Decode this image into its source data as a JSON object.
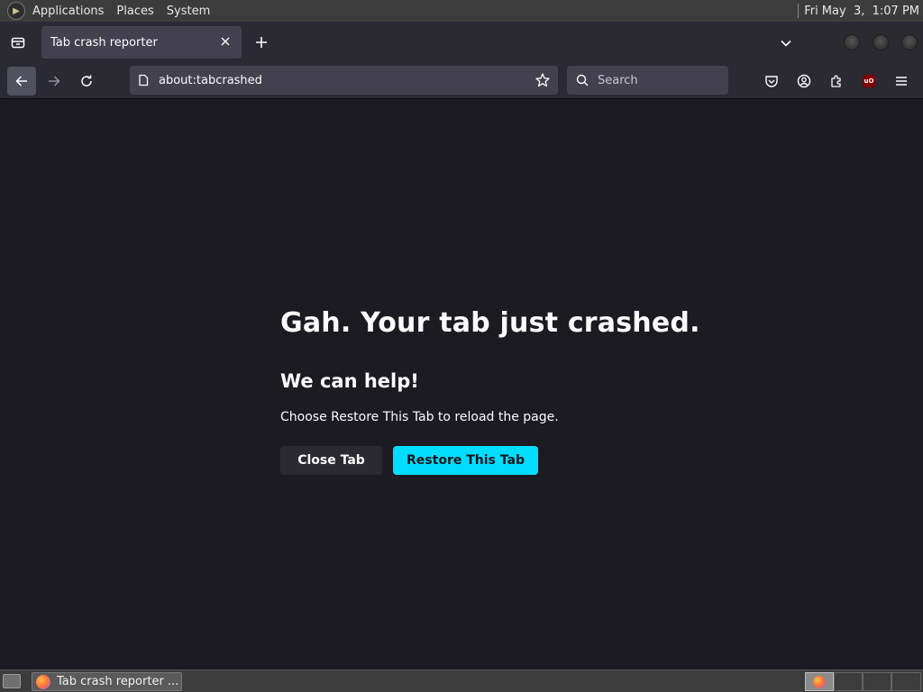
{
  "top_panel": {
    "menu": [
      "Applications",
      "Places",
      "System"
    ],
    "clock": "Fri May  3,  1:07 PM"
  },
  "tabs": [
    {
      "title": "Tab crash reporter",
      "active": true
    }
  ],
  "navbar": {
    "url": "about:tabcrashed",
    "search_placeholder": "Search"
  },
  "page": {
    "title": "Gah. Your tab just crashed.",
    "subtitle": "We can help!",
    "message": "Choose Restore This Tab to reload the page.",
    "close_tab_label": "Close Tab",
    "restore_tab_label": "Restore This Tab"
  },
  "taskbar": {
    "window_title": "Tab crash reporter ..."
  },
  "colors": {
    "page_background": "#1c1b22",
    "primary_button": "#00ddff",
    "secondary_button": "#2b2a33",
    "toolbar": "#2b2a33"
  }
}
